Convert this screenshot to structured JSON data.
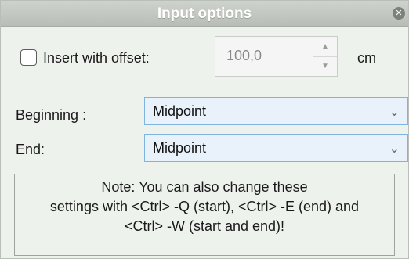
{
  "dialog": {
    "title": "Input options",
    "close_icon": "close-icon"
  },
  "offset": {
    "checkbox_checked": false,
    "label": "Insert with offset:",
    "value": "100,0",
    "unit": "cm"
  },
  "beginning": {
    "label": "Beginning :",
    "value": "Midpoint"
  },
  "end": {
    "label": "End:",
    "value": "Midpoint"
  },
  "note": {
    "line1": "Note: You can also change these",
    "line2": "settings with <Ctrl> -Q (start), <Ctrl> -E (end) and",
    "line3": "<Ctrl> -W (start and end)!"
  }
}
